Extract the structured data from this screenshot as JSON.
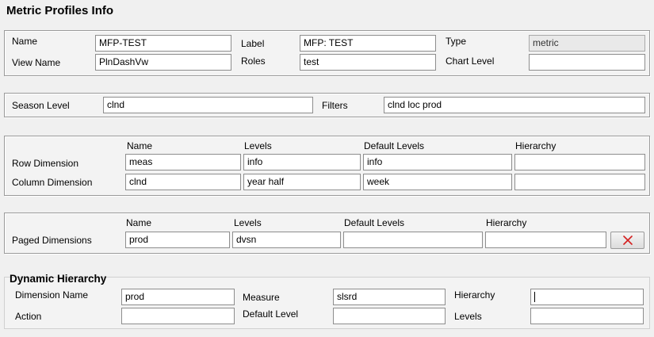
{
  "page": {
    "title": "Metric Profiles Info"
  },
  "profile": {
    "name_label": "Name",
    "name_value": "MFP-TEST",
    "view_name_label": "View Name",
    "view_name_value": "PlnDashVw",
    "label_label": "Label",
    "label_value": "MFP: TEST",
    "roles_label": "Roles",
    "roles_value": "test",
    "type_label": "Type",
    "type_value": "metric",
    "chart_level_label": "Chart Level",
    "chart_level_value": ""
  },
  "season": {
    "season_level_label": "Season Level",
    "season_level_value": "clnd",
    "filters_label": "Filters",
    "filters_value": "clnd loc prod"
  },
  "dimensions": {
    "headers": [
      "Name",
      "Levels",
      "Default Levels",
      "Hierarchy"
    ],
    "rows": [
      {
        "label": "Row Dimension",
        "name": "meas",
        "levels": "info",
        "default_levels": "info",
        "hierarchy": ""
      },
      {
        "label": "Column Dimension",
        "name": "clnd",
        "levels": "year half",
        "default_levels": "week",
        "hierarchy": ""
      }
    ]
  },
  "paged": {
    "headers": [
      "Name",
      "Levels",
      "Default Levels",
      "Hierarchy"
    ],
    "label": "Paged Dimensions",
    "name": "prod",
    "levels": "dvsn",
    "default_levels": "",
    "hierarchy": "",
    "delete_icon": "red-x-icon",
    "delete_color": "#d42020"
  },
  "dynamic": {
    "title": "Dynamic Hierarchy",
    "dimension_name_label": "Dimension Name",
    "dimension_name_value": "prod",
    "measure_label": "Measure",
    "measure_value": "slsrd",
    "hierarchy_label": "Hierarchy",
    "hierarchy_value": "",
    "action_label": "Action",
    "action_value": "",
    "default_level_label": "Default Level",
    "default_level_value": "",
    "levels_label": "Levels",
    "levels_value": ""
  }
}
